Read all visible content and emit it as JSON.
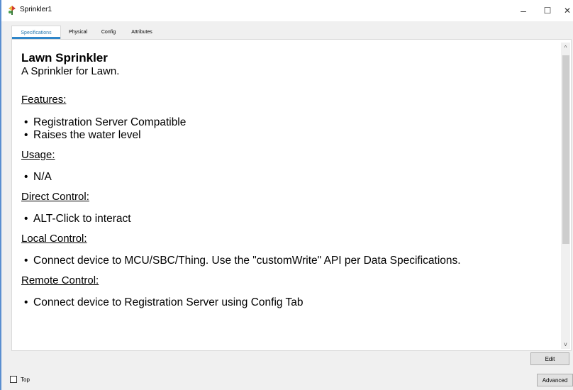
{
  "window": {
    "title": "Sprinkler1",
    "icon": "sprinkler-device-icon",
    "minimize_glyph": "–",
    "maximize_glyph": "☐",
    "close_glyph": "✕"
  },
  "tabs": [
    {
      "label": "Specifications",
      "active": true
    },
    {
      "label": "Physical",
      "active": false
    },
    {
      "label": "Config",
      "active": false
    },
    {
      "label": "Attributes",
      "active": false
    }
  ],
  "document": {
    "title": "Lawn Sprinkler",
    "subtitle": "A Sprinkler for Lawn.",
    "sections": [
      {
        "heading": "Features:",
        "items": [
          "Registration Server Compatible",
          "Raises the water level"
        ]
      },
      {
        "heading": "Usage:",
        "items": [
          "N/A"
        ]
      },
      {
        "heading": "Direct Control:",
        "items": [
          "ALT-Click to interact"
        ]
      },
      {
        "heading": "Local Control:",
        "items": [
          "Connect device to MCU/SBC/Thing. Use the \"customWrite\" API per Data Specifications."
        ]
      },
      {
        "heading": "Remote Control:",
        "items": [
          "Connect device to Registration Server using Config Tab"
        ]
      }
    ]
  },
  "scrollbar": {
    "up_glyph": "^",
    "down_glyph": "v"
  },
  "buttons": {
    "edit": "Edit",
    "advanced": "Advanced"
  },
  "footer": {
    "top_label": "Top",
    "top_checked": false
  },
  "colors": {
    "accent": "#2f86c9",
    "window_border": "#5b8fd0"
  }
}
